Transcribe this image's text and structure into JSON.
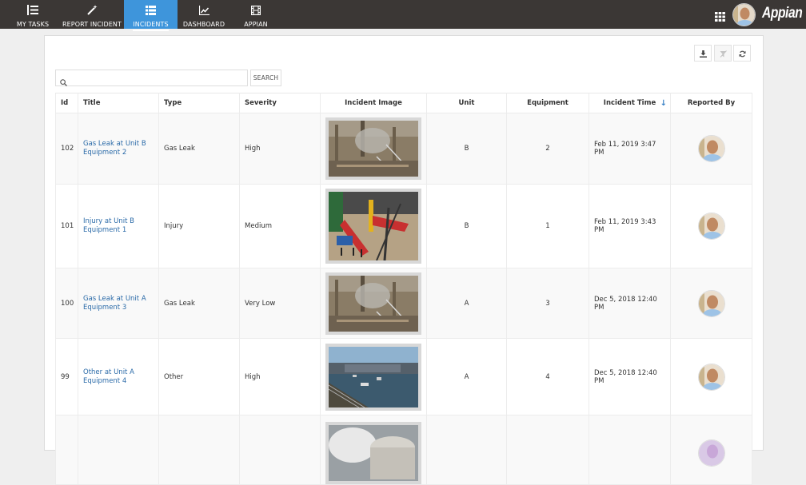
{
  "nav": {
    "tabs": [
      {
        "label": "MY TASKS",
        "icon": "task-list-icon",
        "active": false
      },
      {
        "label": "REPORT INCIDENT",
        "icon": "magic-wand-icon",
        "active": false
      },
      {
        "label": "INCIDENTS",
        "icon": "list-icon",
        "active": true
      },
      {
        "label": "DASHBOARD",
        "icon": "line-chart-icon",
        "active": false
      },
      {
        "label": "APPIAN",
        "icon": "film-icon",
        "active": false
      }
    ],
    "brand": "Appian",
    "colors": {
      "bar": "#3b3735",
      "active": "#3e95db"
    }
  },
  "toolbar": {
    "download_title": "Download",
    "filter_title": "Filter",
    "refresh_title": "Refresh"
  },
  "search": {
    "value": "",
    "placeholder": "",
    "button_label": "SEARCH"
  },
  "table": {
    "columns": [
      "Id",
      "Title",
      "Type",
      "Severity",
      "Incident Image",
      "Unit",
      "Equipment",
      "Incident Time",
      "Reported By"
    ],
    "sorted_column": "Incident Time",
    "sort_direction": "descending",
    "rows": [
      {
        "id": "102",
        "title": "Gas Leak at Unit B Equipment 2",
        "type": "Gas Leak",
        "severity": "High",
        "image": "refinery-smoke",
        "unit": "B",
        "equipment": "2",
        "time": "Feb 11, 2019 3:47 PM",
        "reporter": "user-avatar"
      },
      {
        "id": "101",
        "title": "Injury at Unit B Equipment 1",
        "type": "Injury",
        "severity": "Medium",
        "image": "collapsed-structure",
        "unit": "B",
        "equipment": "1",
        "time": "Feb 11, 2019 3:43 PM",
        "reporter": "user-avatar"
      },
      {
        "id": "100",
        "title": "Gas Leak at Unit A Equipment 3",
        "type": "Gas Leak",
        "severity": "Very Low",
        "image": "refinery-smoke",
        "unit": "A",
        "equipment": "3",
        "time": "Dec 5, 2018 12:40 PM",
        "reporter": "user-avatar"
      },
      {
        "id": "99",
        "title": "Other at Unit A Equipment 4",
        "type": "Other",
        "severity": "High",
        "image": "flooded-plant",
        "unit": "A",
        "equipment": "4",
        "time": "Dec 5, 2018 12:40 PM",
        "reporter": "user-avatar"
      },
      {
        "id": "",
        "title": "",
        "type": "",
        "severity": "",
        "image": "tank-smoke",
        "unit": "",
        "equipment": "",
        "time": "",
        "reporter": "user-avatar-2"
      }
    ]
  }
}
